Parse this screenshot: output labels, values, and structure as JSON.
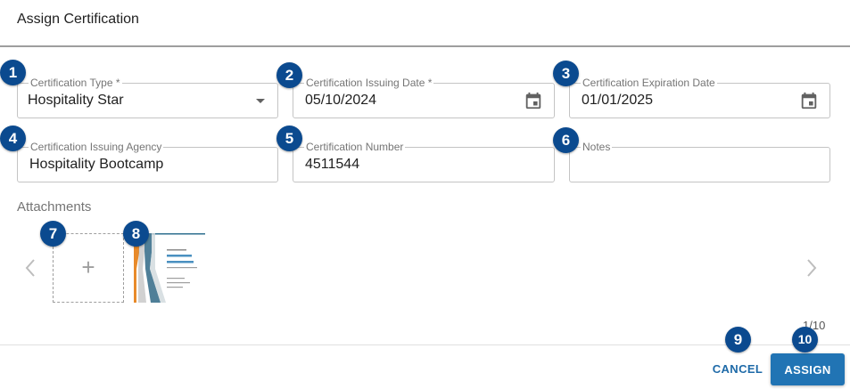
{
  "dialog": {
    "title": "Assign Certification"
  },
  "fields": {
    "certification_type": {
      "label": "Certification Type *",
      "value": "Hospitality Star"
    },
    "issuing_date": {
      "label": "Certification Issuing Date *",
      "value": "05/10/2024"
    },
    "expiration_date": {
      "label": "Certification Expiration Date",
      "value": "01/01/2025"
    },
    "issuing_agency": {
      "label": "Certification Issuing Agency",
      "value": "Hospitality Bootcamp"
    },
    "certification_number": {
      "label": "Certification Number",
      "value": "4511544"
    },
    "notes": {
      "label": "Notes",
      "value": ""
    }
  },
  "attachments": {
    "label": "Attachments",
    "add_symbol": "+",
    "page_count": "1/10"
  },
  "buttons": {
    "cancel": "CANCEL",
    "assign": "ASSIGN"
  },
  "badges": [
    "1",
    "2",
    "3",
    "4",
    "5",
    "6",
    "7",
    "8",
    "9",
    "10"
  ],
  "icons": [
    "calendar-icon",
    "dropdown-caret-icon",
    "chevron-left-icon",
    "chevron-right-icon",
    "plus-icon"
  ],
  "colors": {
    "badge": "#0b4a8f",
    "primary": "#2174b4",
    "cancel_text": "#1e6aa8",
    "border": "#c4c4c4"
  }
}
